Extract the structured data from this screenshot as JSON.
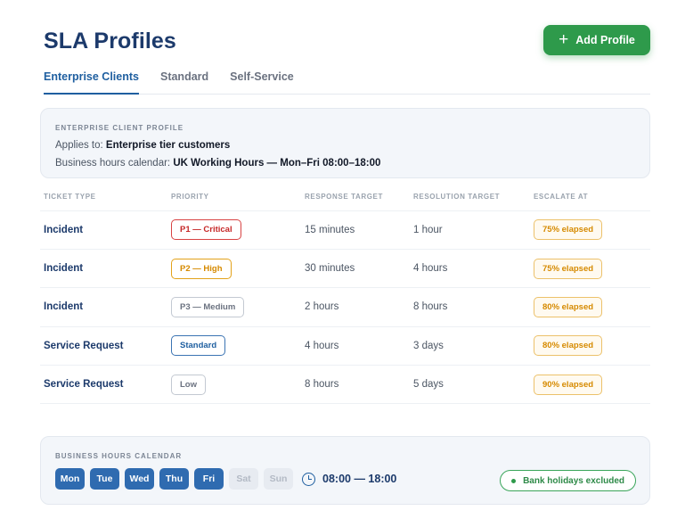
{
  "header": {
    "title": "SLA Profiles",
    "add_label": "Add Profile",
    "add_icon": "plus-icon"
  },
  "tabs": [
    {
      "label": "Enterprise Clients",
      "active": true
    },
    {
      "label": "Standard",
      "active": false
    },
    {
      "label": "Self-Service",
      "active": false
    }
  ],
  "profile": {
    "section_label": "ENTERPRISE CLIENT PROFILE",
    "applies_label": "Applies to:",
    "applies_value": "Enterprise tier customers",
    "calendar_label": "Business hours calendar:",
    "calendar_value": "UK Working Hours — Mon–Fri 08:00–18:00"
  },
  "table": {
    "headers": [
      "TICKET TYPE",
      "PRIORITY",
      "RESPONSE TARGET",
      "RESOLUTION TARGET",
      "ESCALATE AT"
    ],
    "rows": [
      {
        "type": "Incident",
        "priority": "P1 — Critical",
        "response": "15 minutes",
        "resolution": "1 hour",
        "escalate": "75% elapsed"
      },
      {
        "type": "Incident",
        "priority": "P2 — High",
        "response": "30 minutes",
        "resolution": "4 hours",
        "escalate": "75% elapsed"
      },
      {
        "type": "Incident",
        "priority": "P3 — Medium",
        "response": "2 hours",
        "resolution": "8 hours",
        "escalate": "80% elapsed"
      },
      {
        "type": "Service Request",
        "priority": "Standard",
        "response": "4 hours",
        "resolution": "3 days",
        "escalate": "80% elapsed"
      },
      {
        "type": "Service Request",
        "priority": "Low",
        "response": "8 hours",
        "resolution": "5 days",
        "escalate": "90% elapsed"
      }
    ]
  },
  "calendar": {
    "section_label": "BUSINESS HOURS CALENDAR",
    "days": [
      {
        "label": "Mon",
        "enabled": true
      },
      {
        "label": "Tue",
        "enabled": true
      },
      {
        "label": "Wed",
        "enabled": true
      },
      {
        "label": "Thu",
        "enabled": true
      },
      {
        "label": "Fri",
        "enabled": true
      },
      {
        "label": "Sat",
        "enabled": false
      },
      {
        "label": "Sun",
        "enabled": false
      }
    ],
    "hours": "08:00 — 18:00",
    "holiday_badge": "Bank holidays excluded"
  },
  "colors": {
    "accent": "#1f5fa0",
    "primary_button": "#2e9a4b",
    "title": "#1c3a6b",
    "critical": "#c62828",
    "warning": "#d68a00"
  }
}
